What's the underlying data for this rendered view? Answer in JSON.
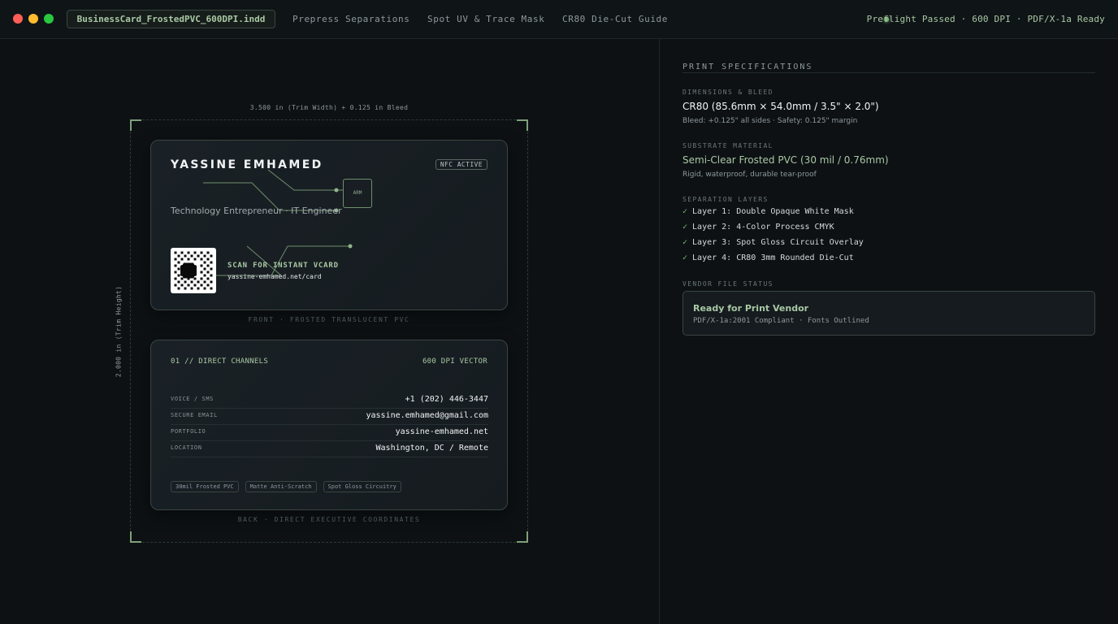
{
  "window": {
    "file_name": "BusinessCard_FrostedPVC_600DPI.indd",
    "tabs": [
      "Prepress Separations",
      "Spot UV & Trace Mask",
      "CR80 Die-Cut Guide"
    ],
    "status": "Preflight Passed · 600 DPI · PDF/X-1a Ready"
  },
  "canvas": {
    "width_label": "3.500 in (Trim Width) + 0.125 in Bleed",
    "height_label": "2.000 in (Trim Height)"
  },
  "front": {
    "name": "YASSINE EMHAMED",
    "badge": "NFC ACTIVE",
    "subtitle": "Technology Entrepreneur · IT Engineer",
    "chip_label": "ARM",
    "scan_label": "SCAN FOR INSTANT VCARD",
    "url": "yassine-emhamed.net/card",
    "caption": "FRONT · FROSTED TRANSLUCENT PVC"
  },
  "back": {
    "header_left": "01 // DIRECT CHANNELS",
    "header_right": "600 DPI VECTOR",
    "rows": [
      {
        "label": "VOICE / SMS",
        "value": "+1 (202) 446-3447"
      },
      {
        "label": "SECURE EMAIL",
        "value": "yassine.emhamed@gmail.com"
      },
      {
        "label": "PORTFOLIO",
        "value": "yassine-emhamed.net"
      },
      {
        "label": "LOCATION",
        "value": "Washington, DC / Remote"
      }
    ],
    "tags": [
      "30mil Frosted PVC",
      "Matte Anti-Scratch",
      "Spot Gloss Circuitry"
    ],
    "caption": "BACK · DIRECT EXECUTIVE COORDINATES"
  },
  "panel": {
    "title": "PRINT SPECIFICATIONS",
    "dimensions": {
      "label": "DIMENSIONS & BLEED",
      "value": "CR80 (85.6mm × 54.0mm / 3.5\" × 2.0\")",
      "sub": "Bleed: +0.125\" all sides · Safety: 0.125\" margin"
    },
    "substrate": {
      "label": "SUBSTRATE MATERIAL",
      "value": "Semi-Clear Frosted PVC (30 mil / 0.76mm)",
      "sub": "Rigid, waterproof, durable tear-proof"
    },
    "layers": {
      "label": "SEPARATION LAYERS",
      "items": [
        "Layer 1: Double Opaque White Mask",
        "Layer 2: 4-Color Process CMYK",
        "Layer 3: Spot Gloss Circuit Overlay",
        "Layer 4: CR80 3mm Rounded Die-Cut"
      ]
    },
    "vendor": {
      "label": "VENDOR FILE STATUS",
      "title": "Ready for Print Vendor",
      "sub": "PDF/X-1a:2001 Compliant · Fonts Outlined"
    }
  },
  "colors": {
    "accent": "#a9c8a4",
    "background": "#0d1114",
    "check": "#7fc07a"
  }
}
